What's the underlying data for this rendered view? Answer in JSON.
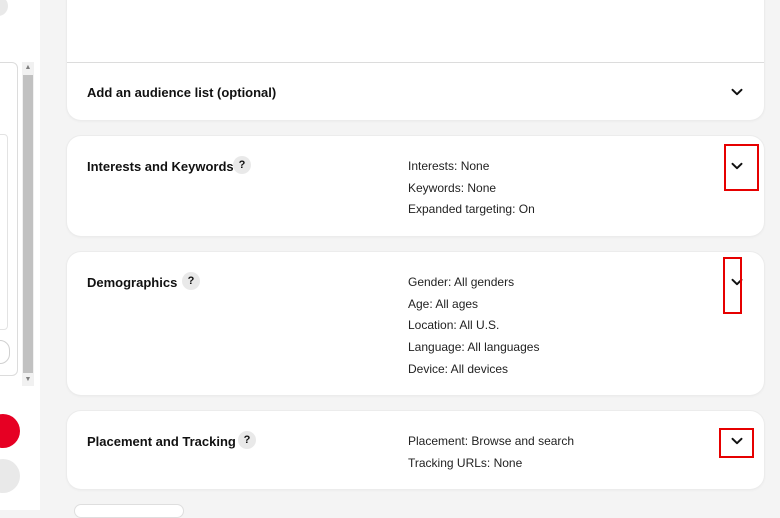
{
  "audience": {
    "title": "Add an audience list (optional)"
  },
  "interests": {
    "title": "Interests and Keywords",
    "help_glyph": "?",
    "summary": [
      "Interests: None",
      "Keywords: None",
      "Expanded targeting: On"
    ]
  },
  "demographics": {
    "title": "Demographics",
    "help_glyph": "?",
    "summary": [
      "Gender: All genders",
      "Age: All ages",
      "Location: All U.S.",
      "Language: All languages",
      "Device: All devices"
    ]
  },
  "placement": {
    "title": "Placement and Tracking",
    "help_glyph": "?",
    "summary": [
      "Placement: Browse and search",
      "Tracking URLs: None"
    ]
  },
  "icons": {
    "chevron": "chevron-down-icon",
    "help": "question-mark-icon"
  },
  "colors": {
    "brand_red": "#e60023",
    "highlight_red": "#e60000",
    "card_bg": "#ffffff",
    "page_bg": "#f4f4f4",
    "help_bg": "#e9e9e9"
  }
}
